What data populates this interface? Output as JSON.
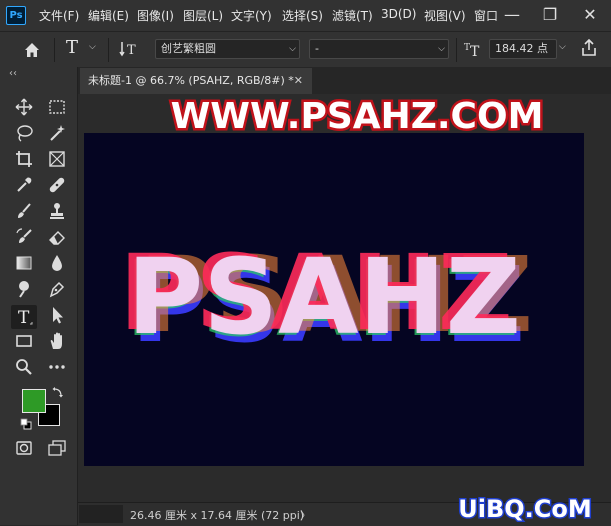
{
  "app": {
    "logo": "Ps"
  },
  "menu": [
    "文件(F)",
    "编辑(E)",
    "图像(I)",
    "图层(L)",
    "文字(Y)",
    "选择(S)",
    "滤镜(T)",
    "3D(D)",
    "视图(V)",
    "窗口"
  ],
  "window_controls": {
    "minimize": "—",
    "restore": "❐",
    "close": "✕"
  },
  "options": {
    "font_family": "创艺繁粗圆",
    "font_style": "-",
    "font_size": "184.42 点"
  },
  "document": {
    "tab_title": "未标题-1 @ 66.7% (PSAHZ, RGB/8#) *",
    "close": "✕",
    "canvas_text": "PSAHZ",
    "status": "26.46 厘米 x 17.64 厘米 (72 ppi)",
    "status_arrow": "〉"
  },
  "watermark_top": "WWW.PSAHZ.COM",
  "watermark_bottom": "UiBQ.CoM",
  "colors": {
    "canvas_bg": "#050522",
    "foreground": "#2e9a26",
    "background": "#000000",
    "text_fill": "#f0d2f0",
    "glitch_red": "#ff2a5a",
    "glitch_blue": "#3a3cff",
    "glitch_green": "#2cc86a",
    "glitch_orange": "#ff8a3a"
  },
  "toolbar_collapse": "‹‹"
}
